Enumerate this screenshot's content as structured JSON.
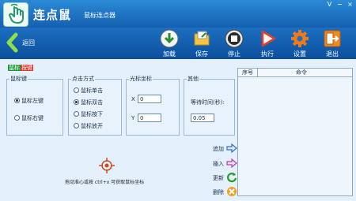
{
  "window": {
    "app_name": "连点鼠",
    "subtitle": "鼠标连点器",
    "controls": [
      "V",
      "−",
      "×"
    ]
  },
  "toolbar": {
    "back_label": "返回",
    "buttons": [
      {
        "label": "加载",
        "icon": "load-icon"
      },
      {
        "label": "保存",
        "icon": "save-icon"
      },
      {
        "label": "停止",
        "icon": "stop-icon"
      },
      {
        "label": "执行",
        "icon": "play-icon"
      },
      {
        "label": "设置",
        "icon": "gear-icon"
      },
      {
        "label": "退出",
        "icon": "exit-icon"
      }
    ]
  },
  "section": {
    "part1": "鼠标",
    "part2": "按键"
  },
  "mouse_key": {
    "legend": "鼠标键",
    "options": [
      {
        "label": "鼠标左键",
        "selected": true
      },
      {
        "label": "鼠标右键",
        "selected": false
      }
    ]
  },
  "click_mode": {
    "legend": "点击方式",
    "options": [
      {
        "label": "鼠标单击",
        "selected": false
      },
      {
        "label": "鼠标双击",
        "selected": true
      },
      {
        "label": "鼠标按下",
        "selected": false
      },
      {
        "label": "鼠标放开",
        "selected": false
      }
    ]
  },
  "cursor": {
    "legend": "光标坐标",
    "x_label": "X",
    "x_value": "0",
    "y_label": "Y",
    "y_value": "0"
  },
  "other": {
    "legend": "其他",
    "wait_label": "等待时间(秒):",
    "wait_value": "0.05"
  },
  "table": {
    "col_index": "序号",
    "col_command": "命令"
  },
  "actions": [
    {
      "label": "追加",
      "icon": "append-arrow-icon",
      "color": "#2f6fd0"
    },
    {
      "label": "插入",
      "icon": "insert-arrow-icon",
      "color": "#b03fb0"
    },
    {
      "label": "更新",
      "icon": "refresh-icon",
      "color": "#2e9a2e"
    },
    {
      "label": "删除",
      "icon": "delete-icon",
      "color": "#f0a020"
    }
  ],
  "hint": "拖动准心或按 ctrl+x 可获取鼠标坐标"
}
